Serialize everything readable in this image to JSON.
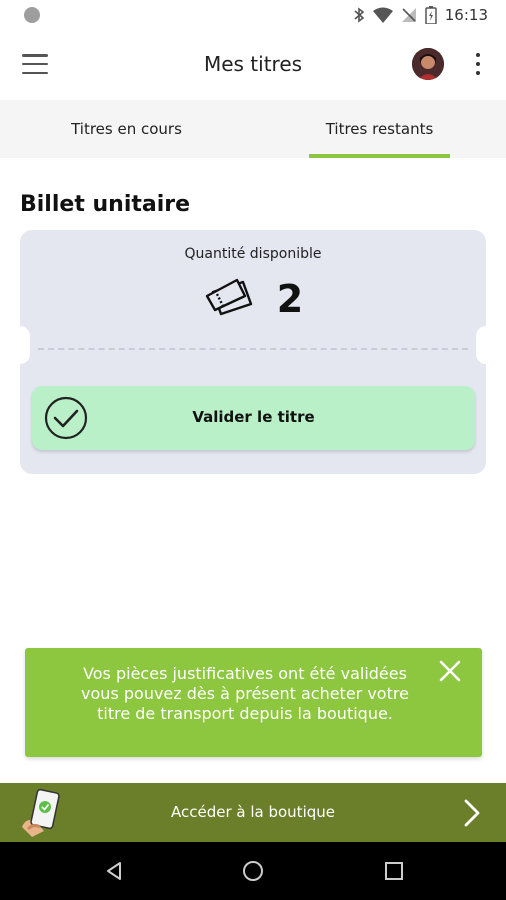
{
  "status_bar": {
    "time": "16:13"
  },
  "app_bar": {
    "title": "Mes titres"
  },
  "tabs": [
    {
      "label": "Titres en cours",
      "active": false
    },
    {
      "label": "Titres restants",
      "active": true
    }
  ],
  "section": {
    "title": "Billet unitaire"
  },
  "ticket": {
    "quantity_label": "Quantité disponible",
    "quantity": "2",
    "validate_label": "Valider le titre"
  },
  "toast": {
    "message": "Vos pièces justificatives ont été validées vous pouvez dès à présent acheter votre titre de transport depuis la boutique."
  },
  "shop": {
    "label": "Accéder à la boutique"
  },
  "colors": {
    "accent": "#8dc63f",
    "shop_bar": "#6b7e29",
    "validate_bg": "#b9f0c8",
    "ticket_bg": "#e4e7f0"
  },
  "icons": {
    "menu": "hamburger-icon",
    "more": "kebab-icon",
    "ticket": "ticket-icon",
    "validate": "check-circle-icon",
    "close": "close-icon",
    "shop": "phone-shop-icon",
    "chevron": "chevron-right-icon"
  }
}
